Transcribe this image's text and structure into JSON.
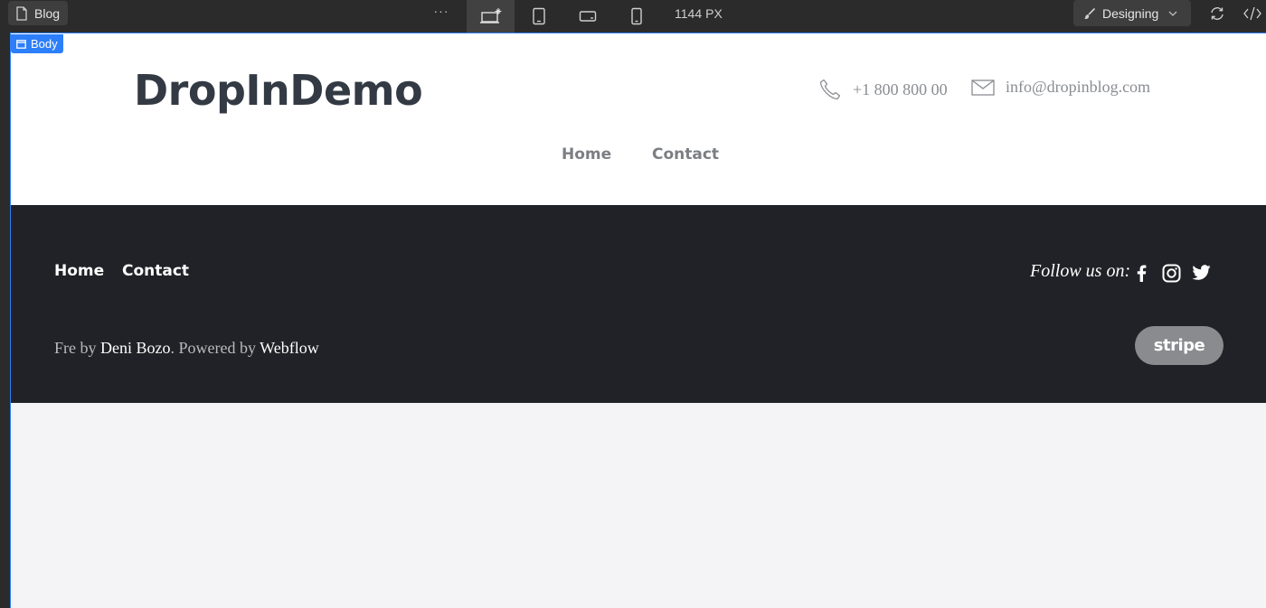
{
  "toolbar": {
    "page_name": "Blog",
    "more_label": "···",
    "canvas_width": "1144",
    "canvas_unit": "PX",
    "mode_label": "Designing",
    "breakpoints": [
      "desktop-base",
      "tablet",
      "mobile-landscape",
      "mobile-portrait"
    ],
    "active_breakpoint": "desktop-base"
  },
  "canvas": {
    "selected_element": "Body",
    "accent_color": "#2d7ff9"
  },
  "site": {
    "logo": "DropInDemo",
    "phone": "+1 800 800 00",
    "email": "info@dropinblog.com",
    "nav": [
      "Home",
      "Contact"
    ]
  },
  "footer": {
    "nav": [
      "Home",
      "Contact"
    ],
    "follow_label": "Follow us on:",
    "social_icons": [
      "facebook-icon",
      "instagram-icon",
      "twitter-icon"
    ],
    "credit_prefix": "Fre by ",
    "credit_author": "Deni Bozo",
    "credit_middle": ". Powered by ",
    "credit_platform": "Webflow",
    "badge": "stripe"
  }
}
